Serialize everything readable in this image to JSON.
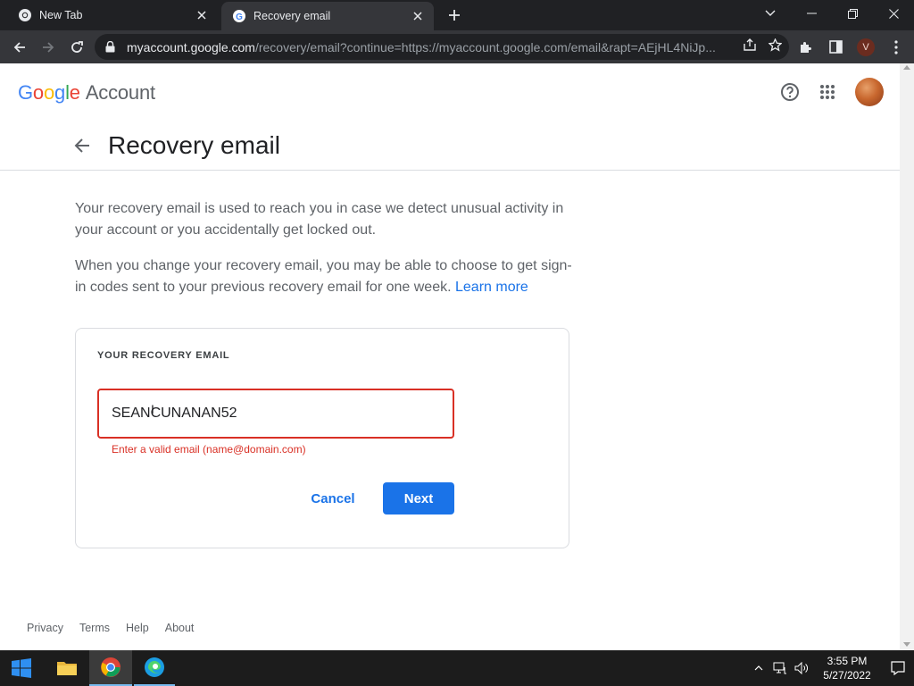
{
  "browser": {
    "tabs": [
      {
        "title": "New Tab",
        "active": false
      },
      {
        "title": "Recovery email",
        "active": true
      }
    ],
    "address": {
      "host": "myaccount.google.com",
      "path": "/recovery/email?continue=https://myaccount.google.com/email&rapt=AEjHL4NiJp..."
    },
    "profile_initial": "V"
  },
  "header": {
    "logo": {
      "g1": "G",
      "o1": "o",
      "o2": "o",
      "g2": "g",
      "l": "l",
      "e": "e",
      "account": "Account"
    }
  },
  "page": {
    "title": "Recovery email",
    "para1": "Your recovery email is used to reach you in case we detect unusual activity in your account or you accidentally get locked out.",
    "para2": "When you change your recovery email, you may be able to choose to get sign-in codes sent to your previous recovery email for one week.",
    "learn_more": "Learn more"
  },
  "form": {
    "label": "YOUR RECOVERY EMAIL",
    "value": "SEANCUNANAN52",
    "cursor": "I",
    "error": "Enter a valid email (name@domain.com)",
    "cancel": "Cancel",
    "next": "Next"
  },
  "footer": {
    "links": [
      "Privacy",
      "Terms",
      "Help",
      "About"
    ]
  },
  "taskbar": {
    "time": "3:55 PM",
    "date": "5/27/2022"
  },
  "colors": {
    "accent": "#1a73e8",
    "error": "#d93025",
    "chrome_dark": "#202124",
    "chrome_toolbar": "#35363a"
  }
}
